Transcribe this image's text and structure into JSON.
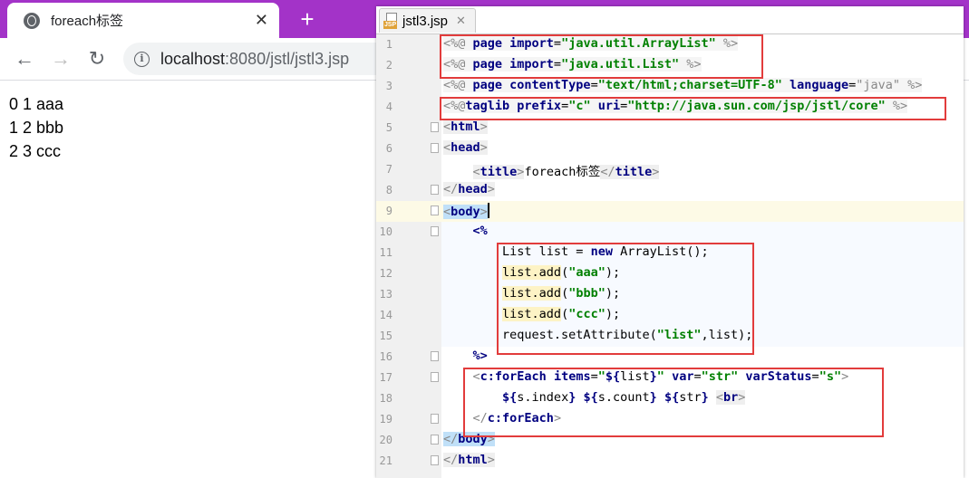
{
  "browser": {
    "tab_title": "foreach标签",
    "close_label": "✕",
    "new_tab_label": "+",
    "back_label": "←",
    "forward_label": "→",
    "reload_label": "↻",
    "info_icon_glyph": "i",
    "url_host": "localhost",
    "url_rest": ":8080/jstl/jstl3.jsp",
    "accent_color": "#a333c8"
  },
  "page_output": {
    "rows": [
      "0 1 aaa",
      "1 2 bbb",
      "2 3 ccc"
    ]
  },
  "ide": {
    "file_tab": "jstl3.jsp",
    "file_badge": "JSP",
    "tab_close": "✕",
    "line_numbers": [
      "1",
      "2",
      "3",
      "4",
      "5",
      "6",
      "7",
      "8",
      "9",
      "10",
      "11",
      "12",
      "13",
      "14",
      "15",
      "16",
      "17",
      "18",
      "19",
      "20",
      "21"
    ],
    "current_line": 9,
    "highlight_color": "#e23c3c"
  }
}
